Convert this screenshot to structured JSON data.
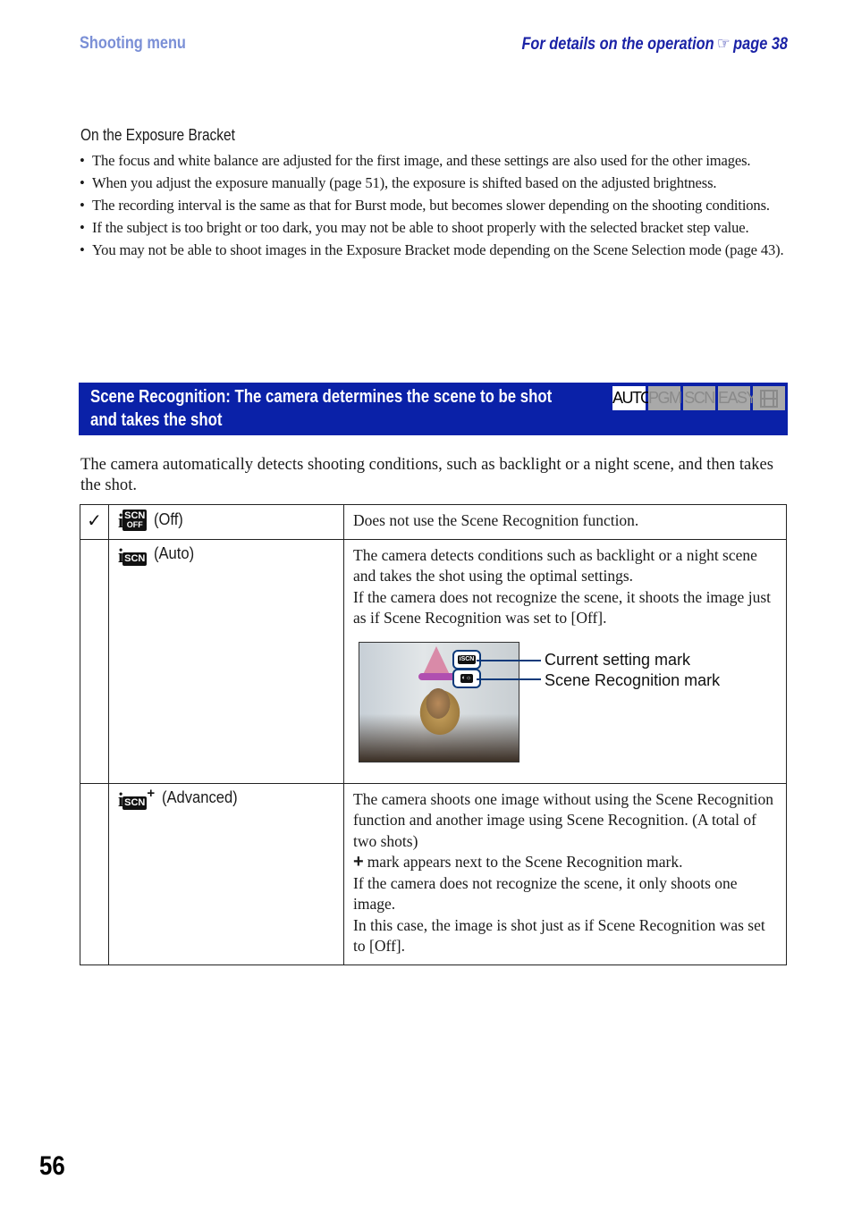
{
  "header": {
    "section": "Shooting menu",
    "details_prefix": "For details on the operation",
    "details_icon": "pointing-hand-icon",
    "details_page": "page 38"
  },
  "note": {
    "title": "On the Exposure Bracket",
    "bullets": [
      "The focus and white balance are adjusted for the first image, and these settings are also used for the other images.",
      "When you adjust the exposure manually (page 51), the exposure is shifted based on the adjusted brightness.",
      "The recording interval is the same as that for Burst mode, but becomes slower depending on the shooting conditions.",
      "If the subject is too bright or too dark, you may not be able to shoot properly with the selected bracket step value.",
      "You may not be able to shoot images in the Exposure Bracket mode depending on the Scene Selection mode (page 43)."
    ]
  },
  "banner": {
    "title_line1": "Scene Recognition: The camera determines the scene to be shot",
    "title_line2": "and takes the shot",
    "color": "#0a21a8",
    "modes": [
      {
        "label": "AUTO",
        "active": true
      },
      {
        "label": "PGM",
        "active": false
      },
      {
        "label": "SCN",
        "active": false
      },
      {
        "label": "EASY",
        "active": false
      },
      {
        "label": "movie-icon",
        "active": false
      }
    ]
  },
  "intro": "The camera automatically detects shooting conditions, such as backlight or a night scene, and then takes the shot.",
  "options": [
    {
      "checked": true,
      "icon": "iscn-off-icon",
      "icon_text": "SCN",
      "icon_sub": "OFF",
      "label": "(Off)",
      "description": "Does not use the Scene Recognition function."
    },
    {
      "checked": false,
      "icon": "iscn-auto-icon",
      "icon_text": "SCN",
      "label": "(Auto)",
      "description_1": "The camera detects conditions such as backlight or a night scene and takes the shot using the optimal settings.",
      "description_2": "If the camera does not recognize the scene, it shoots the image just as if Scene Recognition was set to [Off].",
      "figure": {
        "callout_1": "Current setting mark",
        "callout_2": "Scene Recognition mark"
      }
    },
    {
      "checked": false,
      "icon": "iscn-advanced-icon",
      "icon_text": "SCN",
      "label": "(Advanced)",
      "description_1": "The camera shoots one image without using the Scene Recognition function and another image using Scene Recognition. (A total of two shots)",
      "description_2": "mark appears next to the Scene Recognition mark.",
      "description_3": "If the camera does not recognize the scene, it only shoots one image.",
      "description_4": "In this case, the image is shot just as if Scene Recognition was set to [Off]."
    }
  ],
  "page_number": "56"
}
